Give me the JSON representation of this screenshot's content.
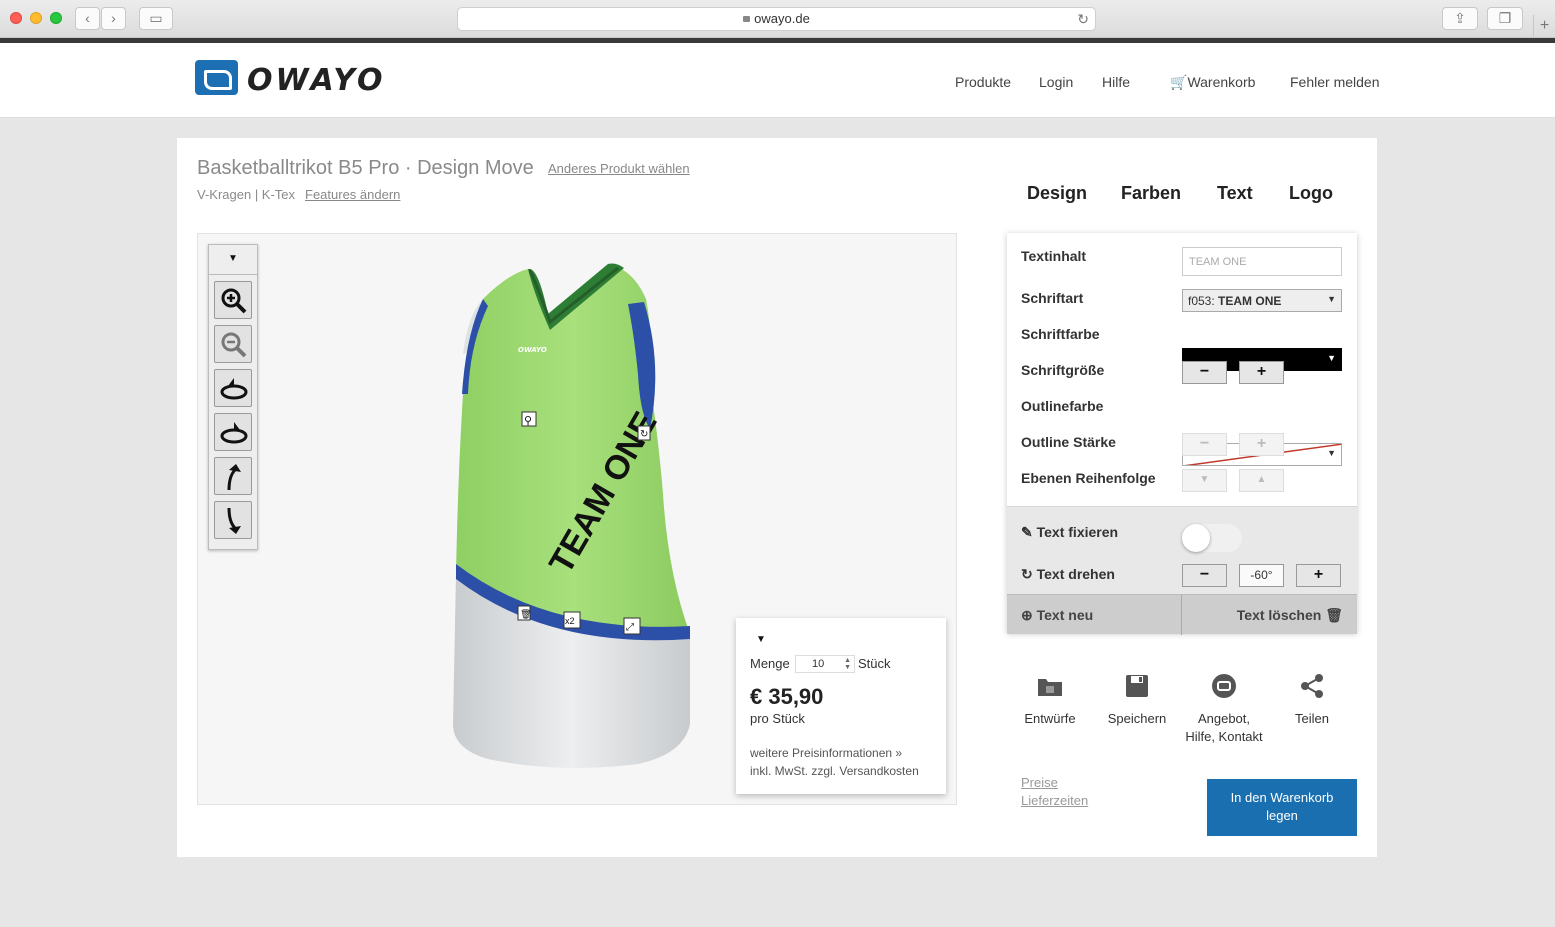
{
  "browser": {
    "url": "owayo.de"
  },
  "header": {
    "logo_text": "OWAYO",
    "nav": [
      "Produkte",
      "Login",
      "Hilfe",
      "Warenkorb",
      "Fehler melden"
    ]
  },
  "product": {
    "title": "Basketballtrikot B5 Pro · Design Move",
    "change_product": "Anderes Produkt wählen",
    "features": "V-Kragen | K-Tex",
    "change_features": "Features ändern"
  },
  "tabs": [
    "Design",
    "Farben",
    "Text",
    "Logo"
  ],
  "viewer": {
    "jersey_text": "TEAM ONE",
    "jersey_brand": "OWAYO",
    "handles": [
      "x2"
    ],
    "toolbar_buttons": [
      "zoom-in",
      "zoom-out",
      "rotate-right",
      "rotate-left",
      "tilt-up",
      "tilt-down"
    ]
  },
  "price_box": {
    "qty_label": "Menge",
    "qty_value": "10",
    "unit": "Stück",
    "price": "€ 35,90",
    "per_piece": "pro Stück",
    "info_line1": "weitere Preisinformationen »",
    "info_line2": "inkl. MwSt. zzgl. Versandkosten"
  },
  "text_panel": {
    "labels": {
      "content": "Textinhalt",
      "font": "Schriftart",
      "font_color": "Schriftfarbe",
      "font_size": "Schriftgröße",
      "outline_color": "Outlinefarbe",
      "outline_width": "Outline Stärke",
      "layer_order": "Ebenen Reihenfolge"
    },
    "content_placeholder": "TEAM ONE",
    "font_code": "f053:",
    "font_name": "TEAM ONE",
    "fix_text": "Text fixieren",
    "rotate_text": "Text drehen",
    "rotation": "-60°",
    "new_text": "Text neu",
    "delete_text": "Text löschen",
    "colors": {
      "font_color": "#000000",
      "outline_line": "#c0392b"
    }
  },
  "actions": [
    {
      "label": "Entwürfe",
      "icon": "folder-icon"
    },
    {
      "label": "Speichern",
      "icon": "save-icon"
    },
    {
      "label_1": "Angebot,",
      "label_2": "Hilfe, Kontakt",
      "icon": "owayo-logo-icon"
    },
    {
      "label": "Teilen",
      "icon": "share-icon"
    }
  ],
  "footer_links": {
    "prices": "Preise",
    "delivery": "Lieferzeiten"
  },
  "cart_button": {
    "line1": "In den Warenkorb",
    "line2": "legen",
    "color": "#1a6fb0"
  }
}
